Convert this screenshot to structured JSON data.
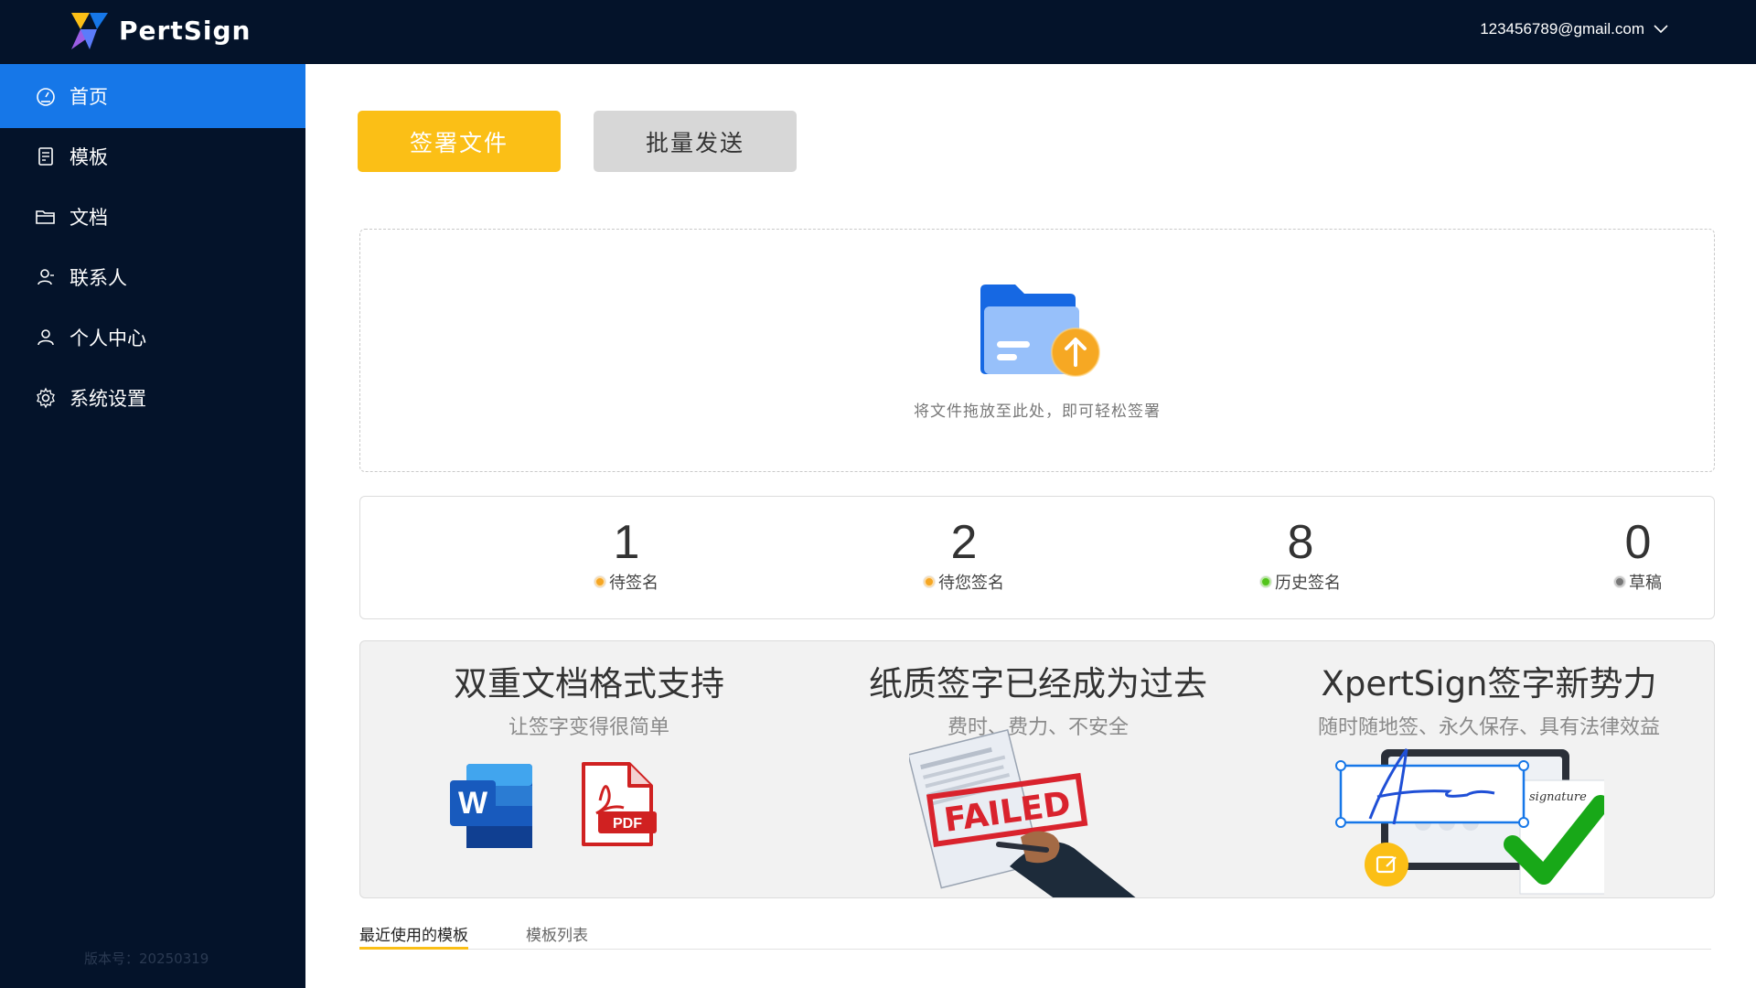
{
  "app": {
    "logo_text": "PertSign"
  },
  "header": {
    "user_email": "123456789@gmail.com"
  },
  "sidebar": {
    "items": [
      {
        "label": "首页",
        "icon": "dashboard-icon",
        "active": true
      },
      {
        "label": "模板",
        "icon": "template-icon",
        "active": false
      },
      {
        "label": "文档",
        "icon": "folder-icon",
        "active": false
      },
      {
        "label": "联系人",
        "icon": "contact-icon",
        "active": false
      },
      {
        "label": "个人中心",
        "icon": "user-icon",
        "active": false
      },
      {
        "label": "系统设置",
        "icon": "gear-icon",
        "active": false
      }
    ],
    "version": "版本号：20250319"
  },
  "actions": {
    "sign_label": "签署文件",
    "batch_label": "批量发送"
  },
  "dropzone": {
    "hint": "将文件拖放至此处，即可轻松签署"
  },
  "stats": [
    {
      "value": "1",
      "label": "待签名",
      "color": "#f5a623"
    },
    {
      "value": "2",
      "label": "待您签名",
      "color": "#f5a623"
    },
    {
      "value": "8",
      "label": "历史签名",
      "color": "#52c41a"
    },
    {
      "value": "0",
      "label": "草稿",
      "color": "#777777"
    }
  ],
  "promos": [
    {
      "title": "双重文档格式支持",
      "subtitle": "让签字变得很简单"
    },
    {
      "title": "纸质签字已经成为过去",
      "subtitle": "费时、费力、不安全",
      "stamp": "FAILED"
    },
    {
      "title": "XpertSign签字新势力",
      "subtitle": "随时随地签、永久保存、具有法律效益"
    }
  ],
  "tabs": [
    {
      "label": "最近使用的模板",
      "active": true
    },
    {
      "label": "模板列表",
      "active": false
    }
  ],
  "colors": {
    "accent": "#1677e8",
    "primary_button": "#fbbf16",
    "nav_bg": "#04132a"
  }
}
